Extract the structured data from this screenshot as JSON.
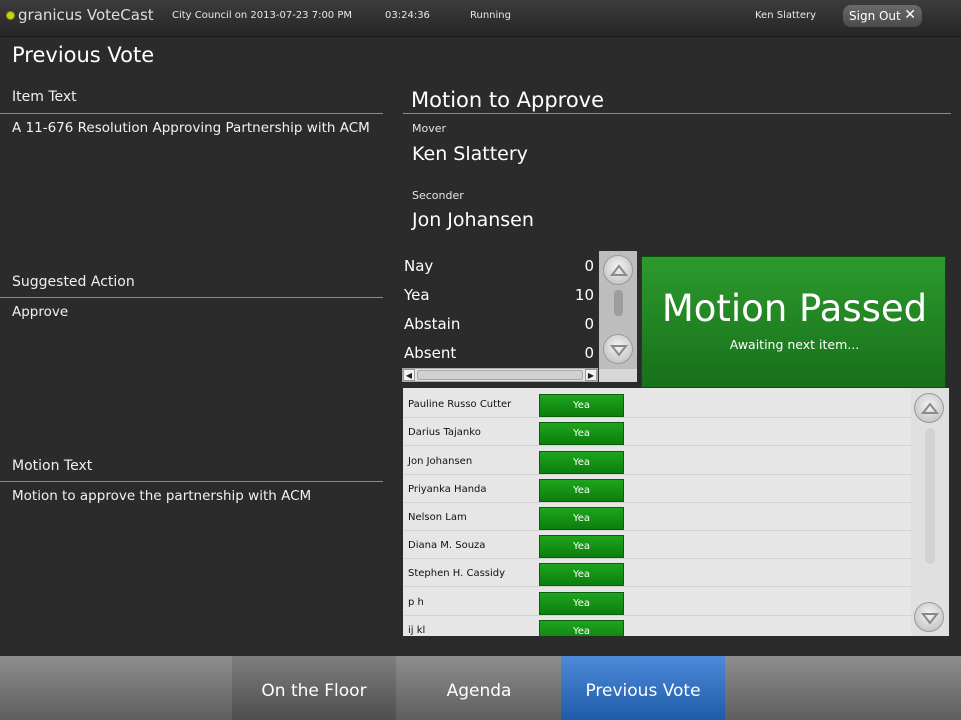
{
  "header": {
    "logo_text": "granicus VoteCast",
    "meeting": "City Council on 2013-07-23 7:00 PM",
    "elapsed": "03:24:36",
    "status": "Running",
    "user": "Ken Slattery",
    "signout_label": "Sign Out",
    "close_glyph": "✕"
  },
  "page_title": "Previous Vote",
  "left": {
    "item_text_label": "Item Text",
    "item_text": "A 11-676 Resolution Approving Partnership with ACM",
    "suggested_action_label": "Suggested Action",
    "suggested_action": "Approve",
    "motion_text_label": "Motion Text",
    "motion_text": "Motion to approve the partnership with ACM"
  },
  "motion": {
    "title": "Motion to Approve",
    "mover_label": "Mover",
    "mover": "Ken Slattery",
    "seconder_label": "Seconder",
    "seconder": "Jon Johansen"
  },
  "tally": [
    {
      "label": "Nay",
      "value": "0"
    },
    {
      "label": "Yea",
      "value": "10"
    },
    {
      "label": "Abstain",
      "value": "0"
    },
    {
      "label": "Absent",
      "value": "0"
    }
  ],
  "result": {
    "title": "Motion Passed",
    "subtitle": "Awaiting next item...",
    "color": "#1f8a22"
  },
  "votes": [
    {
      "name": "Pauline Russo Cutter",
      "vote": "Yea"
    },
    {
      "name": "Darius Tajanko",
      "vote": "Yea"
    },
    {
      "name": "Jon Johansen",
      "vote": "Yea"
    },
    {
      "name": "Priyanka Handa",
      "vote": "Yea"
    },
    {
      "name": "Nelson Lam",
      "vote": "Yea"
    },
    {
      "name": "Diana M. Souza",
      "vote": "Yea"
    },
    {
      "name": "Stephen H. Cassidy",
      "vote": "Yea"
    },
    {
      "name": "p h",
      "vote": "Yea"
    },
    {
      "name": "ij kl",
      "vote": "Yea"
    }
  ],
  "nav": {
    "tabs": [
      {
        "label": "On the Floor",
        "active": false
      },
      {
        "label": "Agenda",
        "active": false
      },
      {
        "label": "Previous Vote",
        "active": true
      }
    ],
    "active_color": "#3a78c6"
  }
}
